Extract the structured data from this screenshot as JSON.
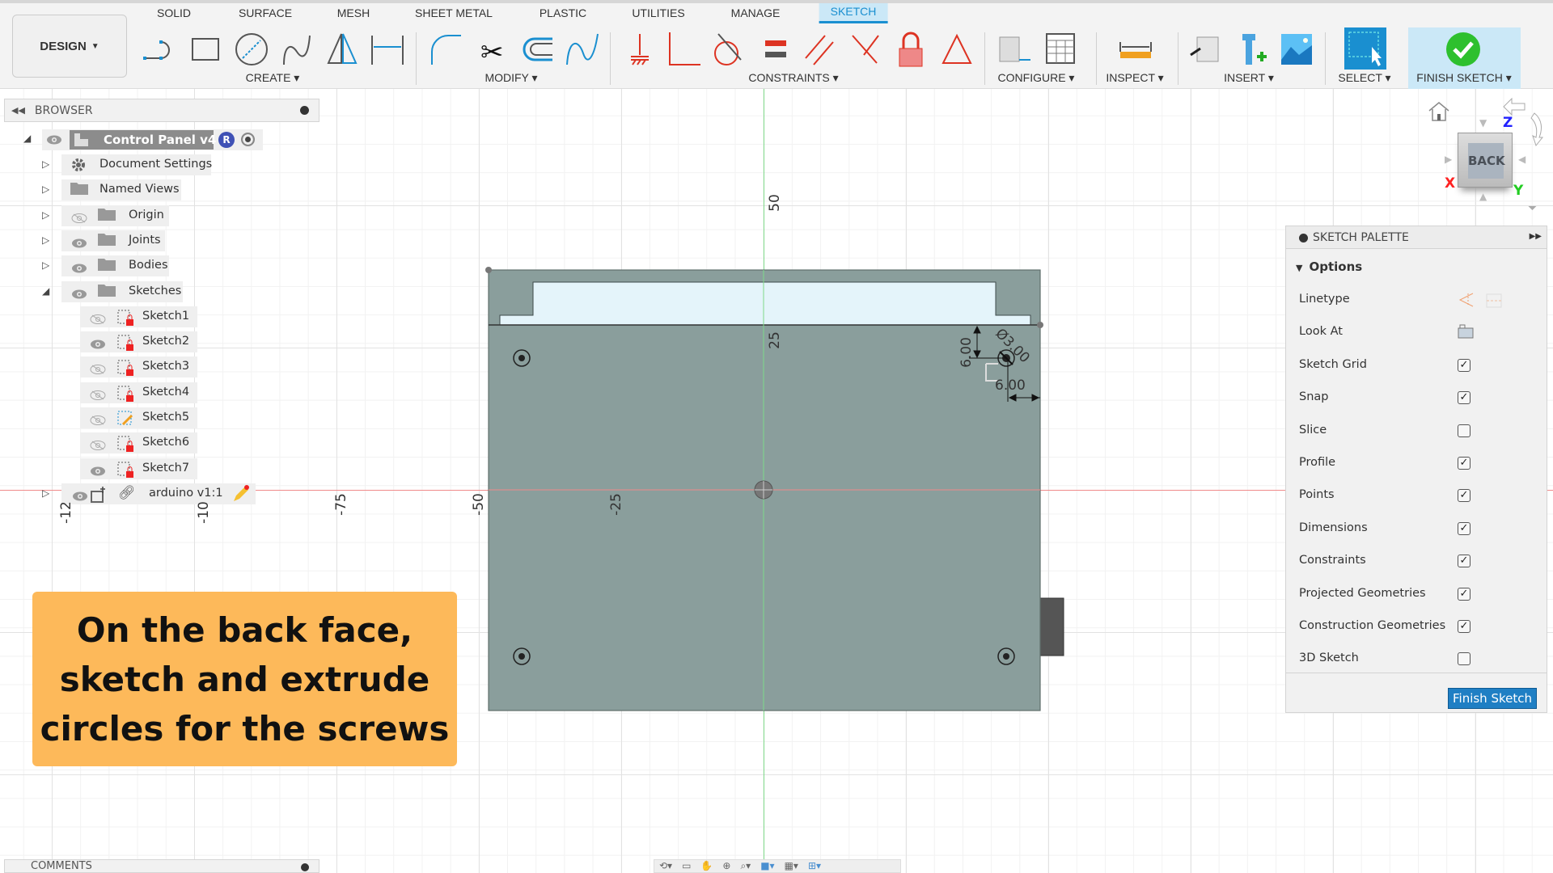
{
  "toolbar": {
    "workspace": "DESIGN",
    "tabs": [
      "SOLID",
      "SURFACE",
      "MESH",
      "SHEET METAL",
      "PLASTIC",
      "UTILITIES",
      "MANAGE",
      "SKETCH"
    ],
    "active_tab": "SKETCH",
    "groups": {
      "create": "CREATE",
      "modify": "MODIFY",
      "constraints": "CONSTRAINTS",
      "configure": "CONFIGURE",
      "inspect": "INSPECT",
      "insert": "INSERT",
      "select": "SELECT",
      "finish": "FINISH SKETCH"
    }
  },
  "browser": {
    "title": "BROWSER",
    "root": {
      "label": "Control Panel v4",
      "badge": "R"
    },
    "items": [
      {
        "label": "Document Settings",
        "icon": "gear-icon",
        "level": 1,
        "eye": "none"
      },
      {
        "label": "Named Views",
        "icon": "folder-icon",
        "level": 1,
        "eye": "none"
      },
      {
        "label": "Origin",
        "icon": "folder-icon",
        "level": 1,
        "eye": "hidden"
      },
      {
        "label": "Joints",
        "icon": "folder-icon",
        "level": 1,
        "eye": "visible"
      },
      {
        "label": "Bodies",
        "icon": "folder-icon",
        "level": 1,
        "eye": "visible"
      },
      {
        "label": "Sketches",
        "icon": "folder-icon",
        "level": 1,
        "eye": "visible",
        "expanded": true
      },
      {
        "label": "Sketch1",
        "icon": "sketch-locked-icon",
        "level": 2,
        "eye": "hidden"
      },
      {
        "label": "Sketch2",
        "icon": "sketch-locked-icon",
        "level": 2,
        "eye": "visible"
      },
      {
        "label": "Sketch3",
        "icon": "sketch-locked-icon",
        "level": 2,
        "eye": "hidden"
      },
      {
        "label": "Sketch4",
        "icon": "sketch-locked-icon",
        "level": 2,
        "eye": "hidden"
      },
      {
        "label": "Sketch5",
        "icon": "sketch-edit-icon",
        "level": 2,
        "eye": "hidden"
      },
      {
        "label": "Sketch6",
        "icon": "sketch-locked-icon",
        "level": 2,
        "eye": "hidden"
      },
      {
        "label": "Sketch7",
        "icon": "sketch-locked-icon",
        "level": 2,
        "eye": "visible"
      }
    ],
    "arduino": {
      "label": "arduino v1:1"
    }
  },
  "viewport": {
    "axis_labels_v": [
      "50",
      "25"
    ],
    "axis_labels_h": [
      "-25",
      "-50",
      "-75",
      "-10",
      "-12"
    ],
    "dimensions": {
      "vertical": "6.00",
      "horizontal": "6.00",
      "diameter": "Ø3.00"
    },
    "colors": {
      "body": "#8a9e9c",
      "slot": "#e4f4fa",
      "x_axis": "#f08a8a",
      "y_axis": "#7fd98a"
    }
  },
  "viewcube": {
    "face": "BACK",
    "x": "X",
    "y": "Y",
    "z": "Z"
  },
  "palette": {
    "title": "SKETCH PALETTE",
    "section": "Options",
    "rows": [
      {
        "label": "Linetype",
        "type": "icons"
      },
      {
        "label": "Look At",
        "type": "button"
      },
      {
        "label": "Sketch Grid",
        "checked": true
      },
      {
        "label": "Snap",
        "checked": true
      },
      {
        "label": "Slice",
        "checked": false
      },
      {
        "label": "Profile",
        "checked": true
      },
      {
        "label": "Points",
        "checked": true
      },
      {
        "label": "Dimensions",
        "checked": true
      },
      {
        "label": "Constraints",
        "checked": true
      },
      {
        "label": "Projected Geometries",
        "checked": true
      },
      {
        "label": "Construction Geometries",
        "checked": true
      },
      {
        "label": "3D Sketch",
        "checked": false
      }
    ],
    "finish_button": "Finish Sketch"
  },
  "callout": {
    "lines": [
      "On the back face,",
      "sketch and extrude",
      "circles for the screws"
    ]
  },
  "comments": {
    "title": "COMMENTS"
  }
}
